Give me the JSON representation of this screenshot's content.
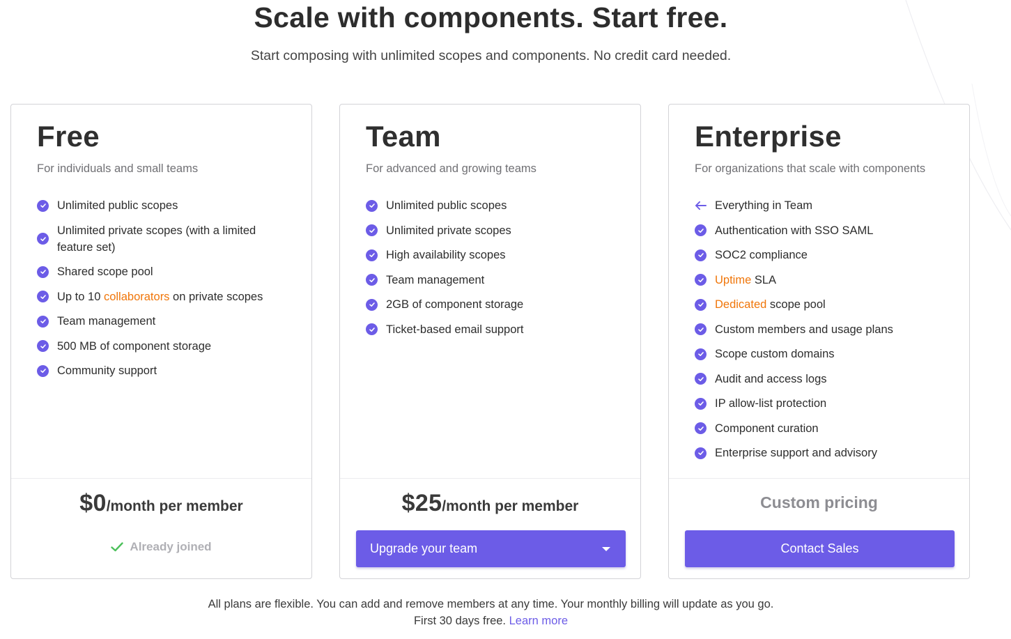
{
  "header": {
    "title": "Scale with components. Start free.",
    "subtitle": "Start composing with unlimited scopes and components. No credit card needed."
  },
  "colors": {
    "accent": "#6c5ce7",
    "highlight": "#f0760a",
    "success": "#4cc05b"
  },
  "plans": [
    {
      "name": "Free",
      "description": "For individuals and small teams",
      "features": [
        {
          "text": "Unlimited public scopes",
          "icon": "check-circle-icon"
        },
        {
          "text": "Unlimited private scopes (with a limited feature set)",
          "icon": "check-circle-icon"
        },
        {
          "text": "Shared scope pool",
          "icon": "check-circle-icon"
        },
        {
          "pre": "Up to 10 ",
          "highlight": "collaborators",
          "post": " on private scopes",
          "icon": "check-circle-icon"
        },
        {
          "text": "Team management",
          "icon": "check-circle-icon"
        },
        {
          "text": "500 MB of component storage",
          "icon": "check-circle-icon"
        },
        {
          "text": "Community support",
          "icon": "check-circle-icon"
        }
      ],
      "price": "$0",
      "price_period": "/month per member",
      "status": "Already joined",
      "status_icon": "checkmark-icon"
    },
    {
      "name": "Team",
      "description": "For advanced and growing teams",
      "features": [
        {
          "text": "Unlimited public scopes",
          "icon": "check-circle-icon"
        },
        {
          "text": "Unlimited private scopes",
          "icon": "check-circle-icon"
        },
        {
          "text": "High availability scopes",
          "icon": "check-circle-icon"
        },
        {
          "text": "Team management",
          "icon": "check-circle-icon"
        },
        {
          "text": "2GB of component storage",
          "icon": "check-circle-icon"
        },
        {
          "text": "Ticket-based email support",
          "icon": "check-circle-icon"
        }
      ],
      "price": "$25",
      "price_period": "/month per member",
      "button_label": "Upgrade your team",
      "button_icon": "caret-down-icon"
    },
    {
      "name": "Enterprise",
      "description": "For organizations that scale with components",
      "features": [
        {
          "text": "Everything in Team",
          "icon": "arrow-left-icon"
        },
        {
          "text": "Authentication with SSO SAML",
          "icon": "check-circle-icon"
        },
        {
          "text": "SOC2 compliance",
          "icon": "check-circle-icon"
        },
        {
          "pre": "",
          "highlight": "Uptime",
          "post": " SLA",
          "icon": "check-circle-icon"
        },
        {
          "pre": "",
          "highlight": "Dedicated",
          "post": " scope pool",
          "icon": "check-circle-icon"
        },
        {
          "text": "Custom members and usage plans",
          "icon": "check-circle-icon"
        },
        {
          "text": "Scope custom domains",
          "icon": "check-circle-icon"
        },
        {
          "text": "Audit and access logs",
          "icon": "check-circle-icon"
        },
        {
          "text": "IP allow-list protection",
          "icon": "check-circle-icon"
        },
        {
          "text": "Component curation",
          "icon": "check-circle-icon"
        },
        {
          "text": "Enterprise support and advisory",
          "icon": "check-circle-icon"
        }
      ],
      "pricing_text": "Custom pricing",
      "button_label": "Contact Sales"
    }
  ],
  "footer": {
    "line1": "All plans are flexible. You can add and remove members at any time. Your monthly billing will update as you go.",
    "line2": "First 30 days free.",
    "link": "Learn more"
  }
}
